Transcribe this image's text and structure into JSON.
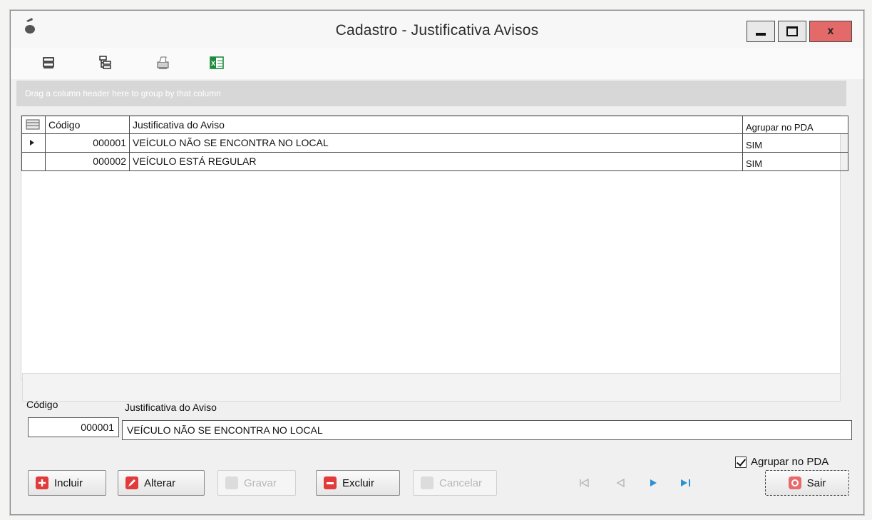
{
  "window": {
    "title": "Cadastro - Justificativa Avisos",
    "close_label": "x"
  },
  "toolbar": {
    "icons": [
      "expand-all-icon",
      "tree-view-icon",
      "print-icon",
      "excel-export-icon"
    ]
  },
  "group_panel": {
    "hint": "Drag a column header here to group by that column"
  },
  "grid": {
    "headers": {
      "codigo": "Código",
      "justificativa": "Justificativa do Aviso",
      "agrupar": "Agrupar no PDA"
    },
    "rows": [
      {
        "codigo": "000001",
        "justificativa": "VEÍCULO NÃO SE ENCONTRA NO LOCAL",
        "agrupar": "SIM"
      },
      {
        "codigo": "000002",
        "justificativa": "VEÍCULO ESTÁ REGULAR",
        "agrupar": "SIM"
      }
    ]
  },
  "form": {
    "codigo_label": "Código",
    "codigo_value": "000001",
    "justificativa_label": "Justificativa do Aviso",
    "justificativa_value": "VEÍCULO NÃO SE ENCONTRA NO LOCAL",
    "agrupar_label": "Agrupar no PDA",
    "agrupar_checked": true
  },
  "buttons": {
    "incluir": "Incluir",
    "alterar": "Alterar",
    "gravar": "Gravar",
    "excluir": "Excluir",
    "cancelar": "Cancelar",
    "sair": "Sair"
  },
  "colors": {
    "red_icon": "#e23b3b",
    "disabled": "#b8b8b8",
    "nav_blue": "#2d8fd6",
    "excel_green": "#1e8a3c"
  }
}
